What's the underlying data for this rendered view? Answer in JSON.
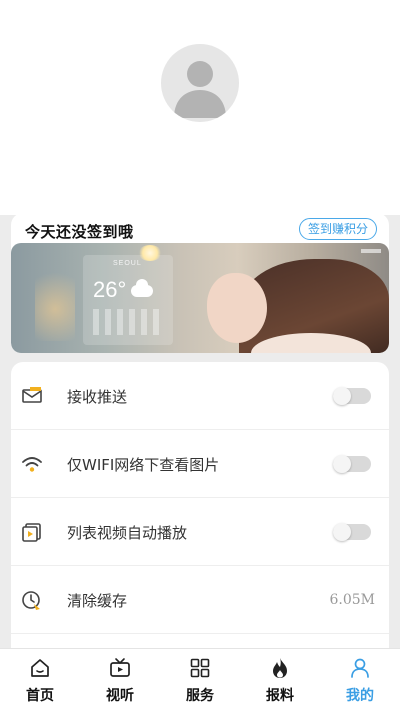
{
  "signin": {
    "title": "今天还没签到哦",
    "button_label": "签到赚积分"
  },
  "banner": {
    "city": "SEOUL",
    "temperature": "26°"
  },
  "settings": {
    "items": [
      {
        "label": "接收推送",
        "icon": "mail-icon",
        "type": "toggle",
        "on": false
      },
      {
        "label": "仅WIFI网络下查看图片",
        "icon": "wifi-icon",
        "type": "toggle",
        "on": false
      },
      {
        "label": "列表视频自动播放",
        "icon": "video-play-icon",
        "type": "toggle",
        "on": false
      },
      {
        "label": "清除缓存",
        "icon": "clock-broom-icon",
        "type": "value",
        "value": "6.05M"
      }
    ]
  },
  "tabbar": {
    "items": [
      {
        "label": "首页",
        "icon": "home-icon",
        "active": false
      },
      {
        "label": "视听",
        "icon": "tv-icon",
        "active": false
      },
      {
        "label": "服务",
        "icon": "grid-icon",
        "active": false
      },
      {
        "label": "报料",
        "icon": "flame-icon",
        "active": false
      },
      {
        "label": "我的",
        "icon": "person-icon",
        "active": true
      }
    ]
  },
  "colors": {
    "accent": "#3a9ee4",
    "background_gray": "#ececec",
    "text_primary": "#333333",
    "text_secondary": "#999999"
  }
}
